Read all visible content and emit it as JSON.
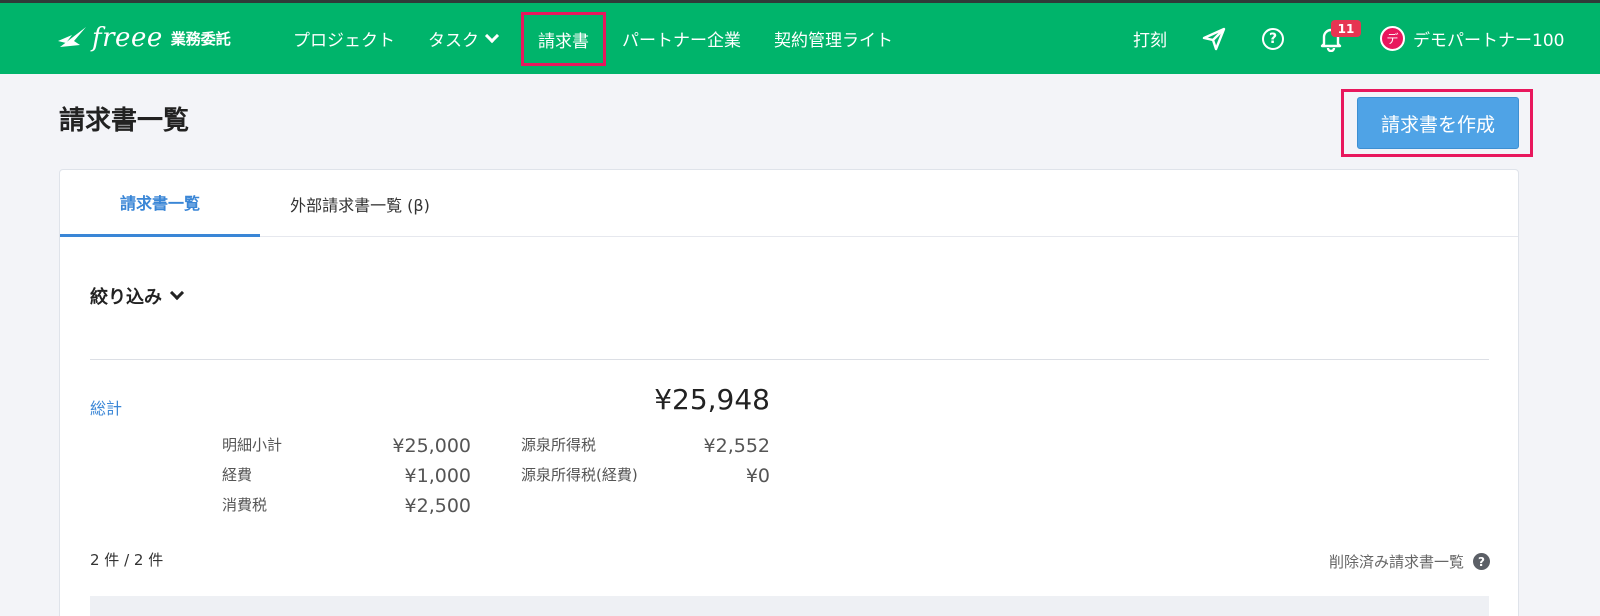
{
  "header": {
    "logo_word": "freee",
    "logo_sub": "業務委託",
    "nav": {
      "project": "プロジェクト",
      "task": "タスク",
      "invoice": "請求書",
      "partner": "パートナー企業",
      "contract": "契約管理ライト"
    },
    "clock_in": "打刻",
    "notification_count": "11",
    "user_initial": "デ",
    "user_name": "デモパートナー100",
    "brand_color": "#00b46b",
    "highlight_color": "#e8175d"
  },
  "page": {
    "title": "請求書一覧",
    "create_button": "請求書を作成"
  },
  "tabs": {
    "invoice_list": "請求書一覧",
    "external_list": "外部請求書一覧 (β)"
  },
  "filter_label": "絞り込み",
  "summary": {
    "total_label": "総計",
    "total_value": "¥25,948",
    "subtotal_label": "明細小計",
    "subtotal_value": "¥25,000",
    "expense_label": "経費",
    "expense_value": "¥1,000",
    "tax_label": "消費税",
    "tax_value": "¥2,500",
    "withholding_label": "源泉所得税",
    "withholding_value": "¥2,552",
    "withholding_expense_label": "源泉所得税(経費)",
    "withholding_expense_value": "¥0"
  },
  "list": {
    "count": "2 件 / 2 件",
    "deleted_link": "削除済み請求書一覧",
    "help": "?"
  }
}
